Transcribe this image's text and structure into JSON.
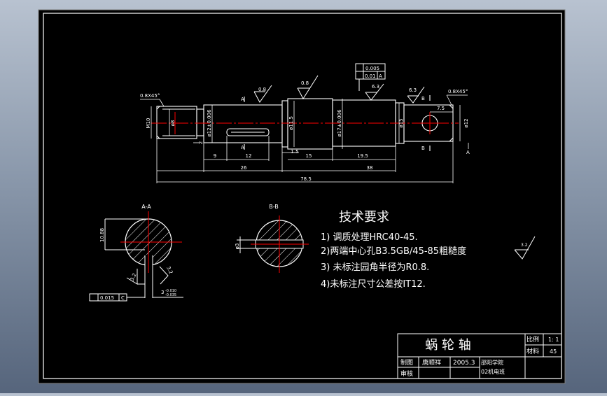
{
  "colors": {
    "background": "#000000",
    "line": "#ffffff",
    "centerline": "#ff0000",
    "frame_outer": "#7f7f7f"
  },
  "dims": {
    "chamfer_left": "0.8X45°",
    "chamfer_right": "0.8X45°",
    "m10": "M10",
    "d8": "ø8",
    "d12_tol": "ø12±0.006",
    "d11_5": "ø11.5",
    "d17_tol": "ø17±0.006",
    "d15": "ø15",
    "d12_right": "ø12",
    "len_9": "9",
    "len_12": "12",
    "len_1_5": "1.5",
    "len_15": "15",
    "len_19_5": "19.5",
    "len_26": "26",
    "len_38": "38",
    "len_78_5": "78.5",
    "len_7_5": "7.5",
    "len_2": "2",
    "rough_08_a": "0.8",
    "rough_08_b": "0.8",
    "rough_63_a": "6.3",
    "rough_63_b": "6.3",
    "tol_flat": "0.005",
    "tol_runout": "0.01",
    "tol_datum": "A",
    "section_a_left": "A",
    "section_a_bottom": "A",
    "section_b_top": "B",
    "section_b_bottom": "B",
    "datum_a": "A"
  },
  "sections": {
    "aa_title": "A-A",
    "aa_dim": "10.88",
    "aa_rough_left": "3.2",
    "aa_rough_right": "3.2",
    "aa_key_width": "3",
    "aa_tol": "-0.010",
    "aa_tol2": "-0.035",
    "aa_sym": "0.015",
    "aa_sym_datum": "C",
    "bb_title": "B-B",
    "bb_dim": "ø3"
  },
  "requirements": {
    "title": "技术要求",
    "items": [
      "1) 调质处理HRC40-45.",
      "2)两端中心孔B3.5GB/45-85粗糙度",
      "3) 未标注园角半径为R0.8.",
      "4)未标注尺寸公差按IT12."
    ],
    "rough_value": "3.2"
  },
  "title_block": {
    "part_name": "蜗 轮 轴",
    "scale_label": "比例",
    "scale_value": "1: 1",
    "material_label": "材料",
    "material_value": "45",
    "drawn_label": "制图",
    "drawn_name": "唐顺祥",
    "date": "2005.3",
    "school": "邵阳学院",
    "class": "02机电班",
    "check_label": "审核"
  }
}
